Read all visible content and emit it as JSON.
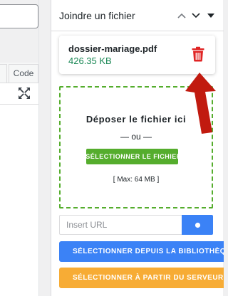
{
  "editor": {
    "code_tab_label": "Code",
    "fullscreen_icon": "expand-arrows-icon"
  },
  "panel": {
    "title": "Joindre un fichier",
    "header_icons": [
      "chevron-up-icon",
      "chevron-down-icon",
      "caret-down-icon"
    ]
  },
  "file": {
    "name": "dossier-mariage.pdf",
    "size": "426.35 KB",
    "delete_icon": "trash-icon"
  },
  "dropzone": {
    "title": "Déposer le fichier ici",
    "or_text": "— ou —",
    "select_button": "SÉLECTIONNER LE FICHIER",
    "max_text": "[ Max: 64 MB ]"
  },
  "url": {
    "placeholder": "Insert URL",
    "button_icon": "dot-icon"
  },
  "buttons": {
    "library": "SÉLECTIONNER DEPUIS LA BIBLIOTHÈQUE",
    "server": "SÉLECTIONNER À PARTIR DU SERVEUR"
  },
  "colors": {
    "accent_green": "#55ad2d",
    "size_green": "#198754",
    "accent_blue": "#3b82f6",
    "accent_orange": "#f7ac35",
    "delete_red": "#e02424",
    "arrow_red": "#c11a0f"
  }
}
